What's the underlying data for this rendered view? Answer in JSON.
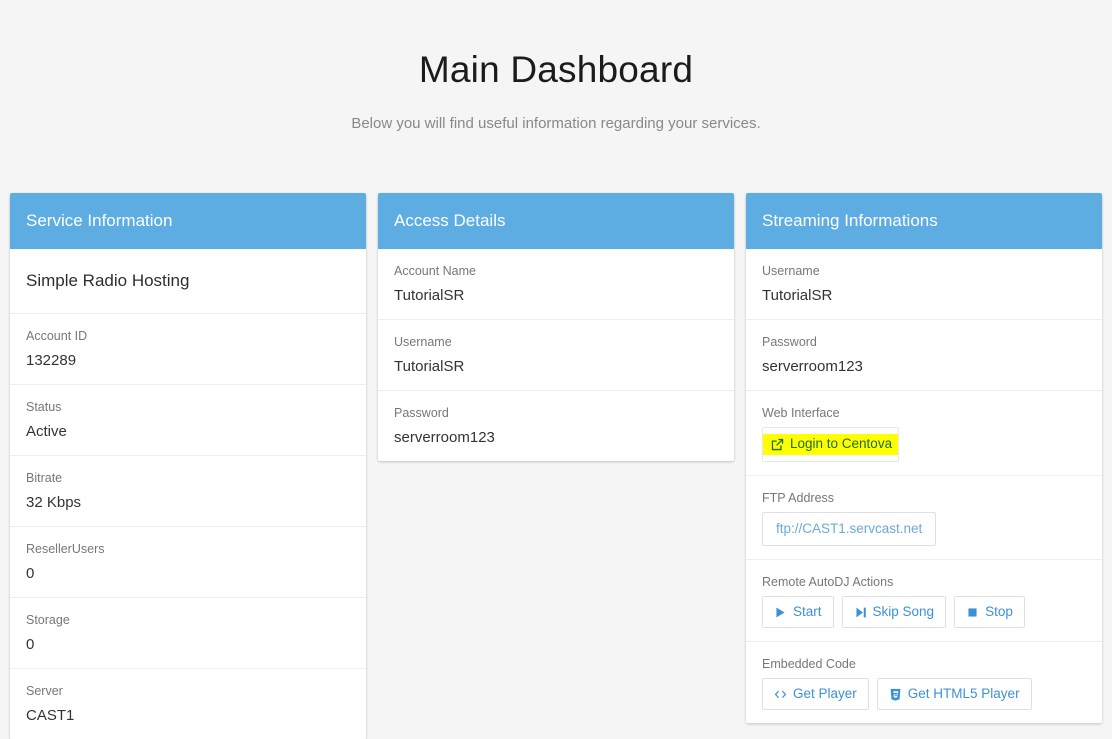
{
  "header": {
    "title": "Main Dashboard",
    "subtitle": "Below you will find useful information regarding your services."
  },
  "colors": {
    "card_header_bg": "#5dade2",
    "page_bg": "#f5f5f5",
    "card_bg": "#ffffff",
    "link_blue": "#3c91d6",
    "highlight_yellow": "#ffff00",
    "highlight_text": "#1d6b2f",
    "divider": "#eeeeee"
  },
  "cards": [
    {
      "id": "service-information",
      "header": "Service Information",
      "rows": [
        {
          "type": "title",
          "value": "Simple Radio Hosting"
        },
        {
          "type": "field",
          "label": "Account ID",
          "value": "132289"
        },
        {
          "type": "field",
          "label": "Status",
          "value": "Active"
        },
        {
          "type": "field",
          "label": "Bitrate",
          "value": "32 Kbps"
        },
        {
          "type": "field",
          "label": "ResellerUsers",
          "value": "0"
        },
        {
          "type": "field",
          "label": "Storage",
          "value": "0"
        },
        {
          "type": "field",
          "label": "Server",
          "value": "CAST1"
        }
      ]
    },
    {
      "id": "access-details",
      "header": "Access Details",
      "rows": [
        {
          "type": "field",
          "label": "Account Name",
          "value": "TutorialSR"
        },
        {
          "type": "field",
          "label": "Username",
          "value": "TutorialSR"
        },
        {
          "type": "field",
          "label": "Password",
          "value": "serverroom123"
        }
      ]
    },
    {
      "id": "streaming-informations",
      "header": "Streaming Informations",
      "rows": [
        {
          "type": "field",
          "label": "Username",
          "value": "TutorialSR"
        },
        {
          "type": "field",
          "label": "Password",
          "value": "serverroom123"
        },
        {
          "type": "buttons",
          "label": "Web Interface",
          "buttons": [
            {
              "icon": "external-link-icon",
              "label": "Login to Centova",
              "style": "highlight"
            }
          ]
        },
        {
          "type": "buttons",
          "label": "FTP Address",
          "buttons": [
            {
              "icon": "none",
              "label": "ftp://CAST1.servcast.net",
              "style": "link"
            }
          ]
        },
        {
          "type": "buttons",
          "label": "Remote AutoDJ Actions",
          "buttons": [
            {
              "icon": "play-icon",
              "label": "Start",
              "style": "default"
            },
            {
              "icon": "step-forward-icon",
              "label": "Skip Song",
              "style": "default"
            },
            {
              "icon": "stop-icon",
              "label": "Stop",
              "style": "default"
            }
          ]
        },
        {
          "type": "buttons",
          "label": "Embedded Code",
          "buttons": [
            {
              "icon": "code-icon",
              "label": "Get Player",
              "style": "default"
            },
            {
              "icon": "html5-icon",
              "label": "Get HTML5 Player",
              "style": "default"
            }
          ]
        }
      ]
    }
  ]
}
